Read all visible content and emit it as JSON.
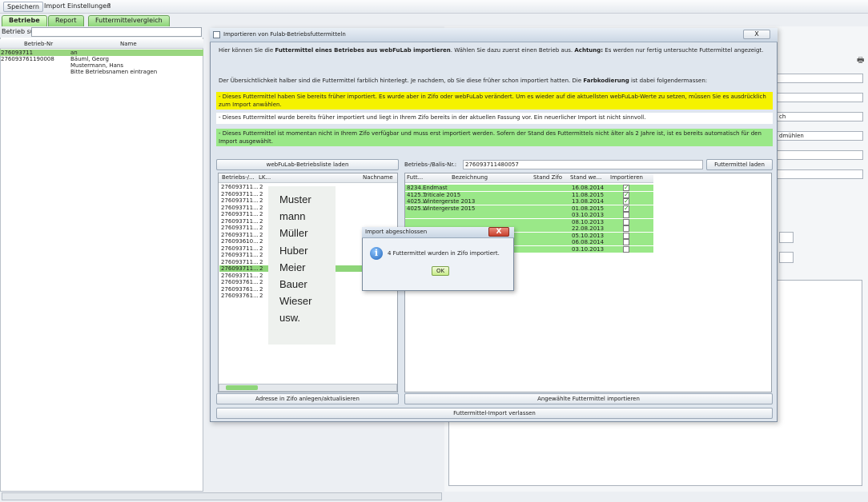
{
  "menu": {
    "save": "Speichern",
    "import": "Import",
    "settings": "Einstellungen",
    "help": "?"
  },
  "tabs": [
    "Betriebe",
    "Report",
    "Futtermittelvergleich"
  ],
  "left": {
    "search_label": "Betrieb suchen:",
    "col_nr": "Betrieb-Nr",
    "col_name": "Name",
    "rows": [
      {
        "nr": "276093711",
        "name": "an"
      },
      {
        "nr": "276093761190008",
        "name": "Bäuml, Georg"
      },
      {
        "nr": "",
        "name": "Mustermann, Hans"
      },
      {
        "nr": "",
        "name": "Bitte Betriebsnamen eintragen"
      }
    ]
  },
  "right": {
    "field_ch": "ch",
    "field_muehlen": "dmühlen"
  },
  "dialog": {
    "title": "Importieren von Fulab-Betriebsfuttermitteln",
    "close": "X",
    "intro_a": "Hier können Sie die ",
    "intro_b": "Futtermittel eines Betriebes aus webFuLab importieren",
    "intro_c": ". Wählen Sie dazu zuerst einen Betrieb aus. ",
    "intro_d": "Achtung:",
    "intro_e": " Es werden nur fertig untersuchte Futtermittel angezeigt.",
    "legend_a": "Der Übersichtlichkeit halber sind die Futtermittel farblich hinterlegt. Je nachdem, ob Sie diese früher schon importiert hatten. Die ",
    "legend_b": "Farbkodierung",
    "legend_c": " ist dabei folgendermassen:",
    "yellow_text": "- Dieses Futtermittel haben Sie bereits früher importiert. Es wurde aber in Zifo oder webFuLab verändert. Um es wieder auf die aktuellsten webFuLab-Werte zu setzen, müssen Sie es ausdrücklich zum Import anwählen.",
    "white_text": "- Dieses Futtermittel wurde bereits früher importiert und liegt in Ihrem Zifo bereits in der aktuellen Fassung vor. Ein neuerlicher Import ist nicht sinnvoll.",
    "green_text": "- Dieses Futtermittel ist momentan nicht in Ihrem Zifo verfügbar und muss erst importiert werden. Sofern der Stand des Futtermittels nicht älter als 2 Jahre ist, ist es bereits automatisch für den Import ausgewählt.",
    "load_list_button": "webFuLab-Betriebsliste laden",
    "balis_label": "Betriebs-/Balis-Nr.:",
    "balis_value": "276093711480057",
    "load_feed_button": "Futtermittel laden",
    "farm_cols": [
      "Betriebs-/...",
      "LK...",
      "Nachname"
    ],
    "farm_nrs": [
      "276093711...",
      "276093711...",
      "276093711...",
      "276093711...",
      "276093711...",
      "276093711...",
      "276093711...",
      "276093711...",
      "276093610...",
      "276093711...",
      "276093711...",
      "276093711...",
      "276093711...",
      "276093711...",
      "276093761...",
      "276093761...",
      "276093761..."
    ],
    "farm_lk": "2",
    "feed_cols": [
      "Futt...",
      "Bezeichnung",
      "Stand Zifo",
      "Stand we...",
      "Importieren"
    ],
    "feed_rows": [
      {
        "code": "8234...",
        "name": "Endmast",
        "stand": "16.08.2014",
        "checked": true
      },
      {
        "code": "4125...",
        "name": "Triticale 2015",
        "stand": "11.08.2015",
        "checked": true
      },
      {
        "code": "4025...",
        "name": "Wintergerste 2013",
        "stand": "13.08.2014",
        "checked": true
      },
      {
        "code": "4025...",
        "name": "Wintergerste 2015",
        "stand": "01.08.2015",
        "checked": true
      },
      {
        "code": "",
        "name": "",
        "stand": "03.10.2013",
        "checked": false
      },
      {
        "code": "",
        "name": "",
        "stand": "08.10.2013",
        "checked": false
      },
      {
        "code": "",
        "name": "",
        "stand": "22.08.2013",
        "checked": false
      },
      {
        "code": "",
        "name": "",
        "stand": "05.10.2013",
        "checked": false
      },
      {
        "code": "",
        "name": "",
        "stand": "06.08.2014",
        "checked": false
      },
      {
        "code": "",
        "name": "",
        "stand": "03.10.2013",
        "checked": false
      }
    ],
    "address_button": "Adresse in Zifo anlegen/aktualisieren",
    "import_button": "Angewählte Futtermittel importieren",
    "exit_button": "Futtermittel-Import verlassen"
  },
  "overlay_names": [
    "Muster",
    "mann",
    "Müller",
    "Huber",
    "Meier",
    "Bauer",
    "Wieser",
    "usw."
  ],
  "message": {
    "title": "Import abgeschlossen",
    "close": "X",
    "text": "4 Futtermittel wurden in Zifo importiert.",
    "ok": "OK",
    "icon": "i"
  }
}
